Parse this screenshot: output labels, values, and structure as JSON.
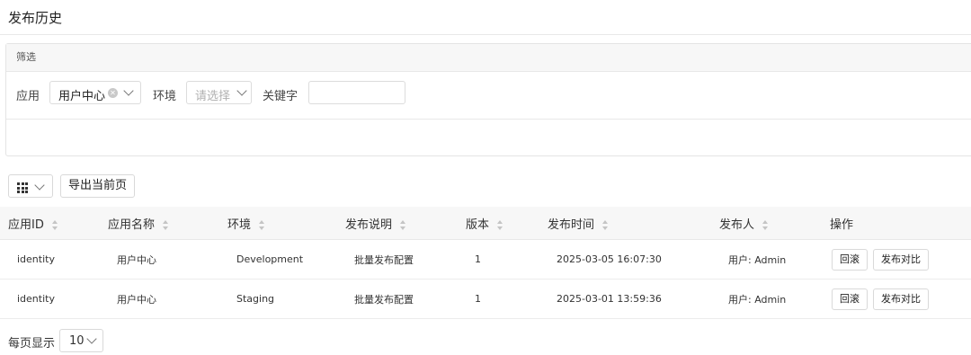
{
  "page": {
    "title": "发布历史"
  },
  "filter": {
    "header": "筛选",
    "app_label": "应用",
    "app_value": "用户中心",
    "env_label": "环境",
    "env_placeholder": "请选择",
    "keyword_label": "关键字",
    "keyword_value": ""
  },
  "toolbar": {
    "export_label": "导出当前页"
  },
  "table": {
    "columns": [
      "应用ID",
      "应用名称",
      "环境",
      "发布说明",
      "版本",
      "发布时间",
      "发布人",
      "操作"
    ],
    "rows": [
      {
        "app_id": "identity",
        "app_name": "用户中心",
        "env": "Development",
        "desc": "批量发布配置",
        "version": "1",
        "time": "2025-03-05 16:07:30",
        "publisher": "用户: Admin",
        "rollback": "回滚",
        "compare": "发布对比"
      },
      {
        "app_id": "identity",
        "app_name": "用户中心",
        "env": "Staging",
        "desc": "批量发布配置",
        "version": "1",
        "time": "2025-03-01 13:59:36",
        "publisher": "用户: Admin",
        "rollback": "回滚",
        "compare": "发布对比"
      }
    ]
  },
  "pager": {
    "label": "每页显示",
    "page_size": "10"
  },
  "icons": [
    "clear-icon",
    "chevron-down-icon",
    "grid-icon",
    "sort-icon"
  ]
}
